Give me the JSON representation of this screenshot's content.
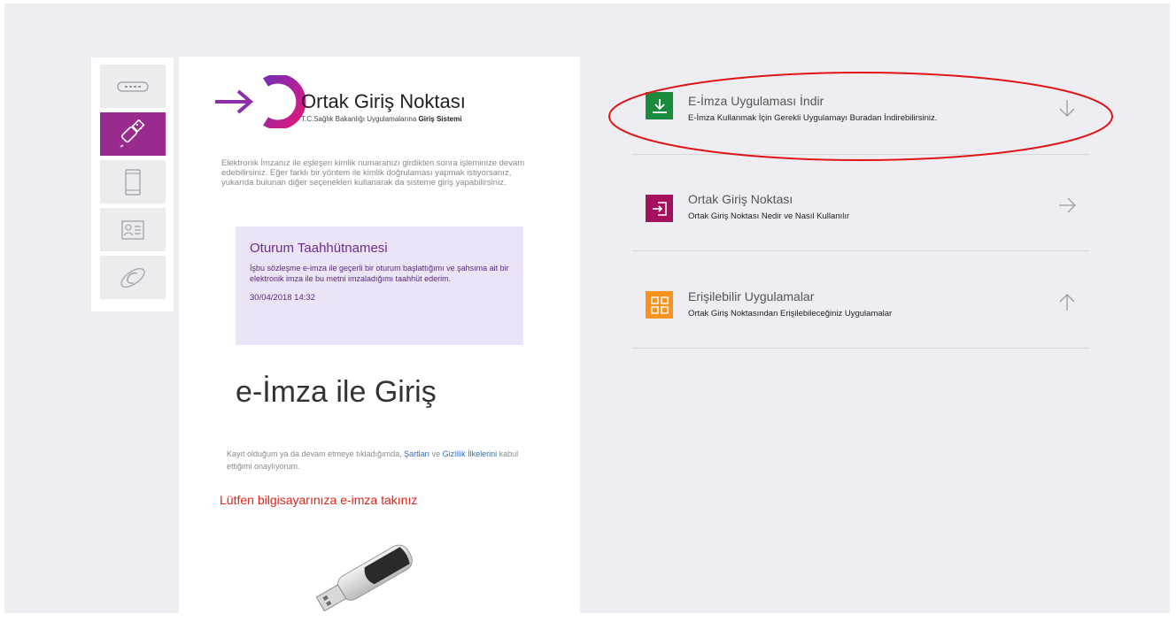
{
  "colors": {
    "accent_purple": "#9a2b8e",
    "download_green": "#1a8a3c",
    "portal_maroon": "#a4125e",
    "apps_orange": "#f7931e",
    "warning_red": "#e0231a",
    "annotation_red": "#e01616",
    "link_blue": "#2a6ebd"
  },
  "tabs": [
    {
      "name": "smart-card-reader",
      "icon": "card-reader-icon",
      "active": false
    },
    {
      "name": "e-imza",
      "icon": "usb-token-icon",
      "active": true
    },
    {
      "name": "mobile",
      "icon": "mobile-phone-icon",
      "active": false
    },
    {
      "name": "id-card",
      "icon": "id-card-icon",
      "active": false
    },
    {
      "name": "e-devlet",
      "icon": "e-devlet-icon",
      "active": false
    }
  ],
  "card": {
    "logo_title": "Ortak Giriş Noktası",
    "logo_sub_prefix": "T.C.Sağlık Bakanlığı Uygulamalarına ",
    "logo_sub_bold": "Giriş Sistemi",
    "intro": "Elektronik İmzanız ile eşleşen kimlik numaranızı girdikten sonra işleminize devam edebilirsiniz. Eğer farklı bir yöntem ile kimlik doğrulaması yapmak istiyorsanız, yukarıda bulunan diğer seçenekleri kullanarak da sisteme giriş yapabilirsiniz.",
    "notice": {
      "title": "Oturum Taahhütnamesi",
      "body": "İşbu sözleşme e-imza ile geçerli bir oturum başlattığımı ve şahsıma ait bir elektronik imza ile bu metni imzaladığımı taahhüt ederim.",
      "date": "30/04/2018 14:32"
    },
    "heading": "e-İmza ile Giriş",
    "terms_prefix": "Kayıt olduğum ya da devam etmeye tıkladığımda, ",
    "terms_link1": "Şartları",
    "terms_mid": " ve ",
    "terms_link2": "Gizlilik İlkelerini",
    "terms_suffix": " kabul ettiğimi onaylıyorum.",
    "warning": "Lütfen bilgisayarınıza e-imza takınız"
  },
  "links": [
    {
      "title": "E-İmza Uygulaması İndir",
      "desc": "E-İmza Kullanmak İçin Gerekli Uygulamayı Buradan İndirebilirsiniz.",
      "icon": "download-icon",
      "arrow": "arrow-down-icon",
      "highlighted": true
    },
    {
      "title": "Ortak Giriş Noktası",
      "desc": "Ortak Giriş Noktası Nedir ve Nasıl Kullanılır",
      "icon": "login-icon",
      "arrow": "arrow-right-icon"
    },
    {
      "title": "Erişilebilir Uygulamalar",
      "desc": "Ortak Giriş Noktasından Erişilebileceğiniz Uygulamalar",
      "icon": "grid-apps-icon",
      "arrow": "arrow-up-icon"
    }
  ]
}
